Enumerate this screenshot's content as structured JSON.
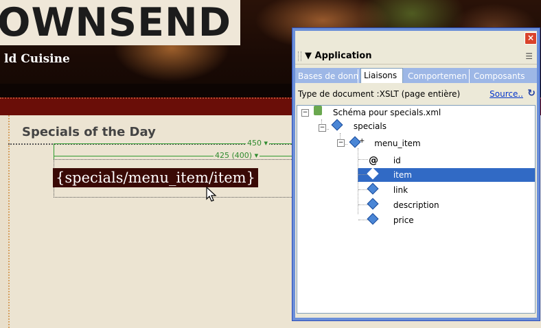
{
  "site": {
    "logo_text": "OWNSEND",
    "tagline": "ld Cuisine"
  },
  "page": {
    "section_title": "Specials of the Day",
    "ruler_outer": "450 ▾",
    "ruler_inner": "425 (400) ▾",
    "xslt_field": "{specials/menu_item/item}"
  },
  "panel": {
    "close": "×",
    "title": "▼ Application",
    "options_icon": "☰",
    "tabs": [
      {
        "label": "Bases de donn"
      },
      {
        "label": "Liaisons",
        "active": true
      },
      {
        "label": "Comportemen"
      },
      {
        "label": "Composants"
      }
    ],
    "doc_type": "Type de document :XSLT (page entière)",
    "source_link": "Source..",
    "refresh_icon": "↻",
    "tree": {
      "root_toggle": "−",
      "root": "Schéma pour specials.xml",
      "specials_toggle": "−",
      "specials": "specials",
      "menu_item_toggle": "−",
      "menu_item": "menu_item",
      "menu_item_badge": "+",
      "children": [
        "id",
        "item",
        "link",
        "description",
        "price"
      ],
      "id_icon": "@",
      "selected": "item"
    }
  },
  "colors": {
    "selection": "#316ac5",
    "panel_frame": "#6b8fd8",
    "ruler": "#2e9a2e"
  }
}
